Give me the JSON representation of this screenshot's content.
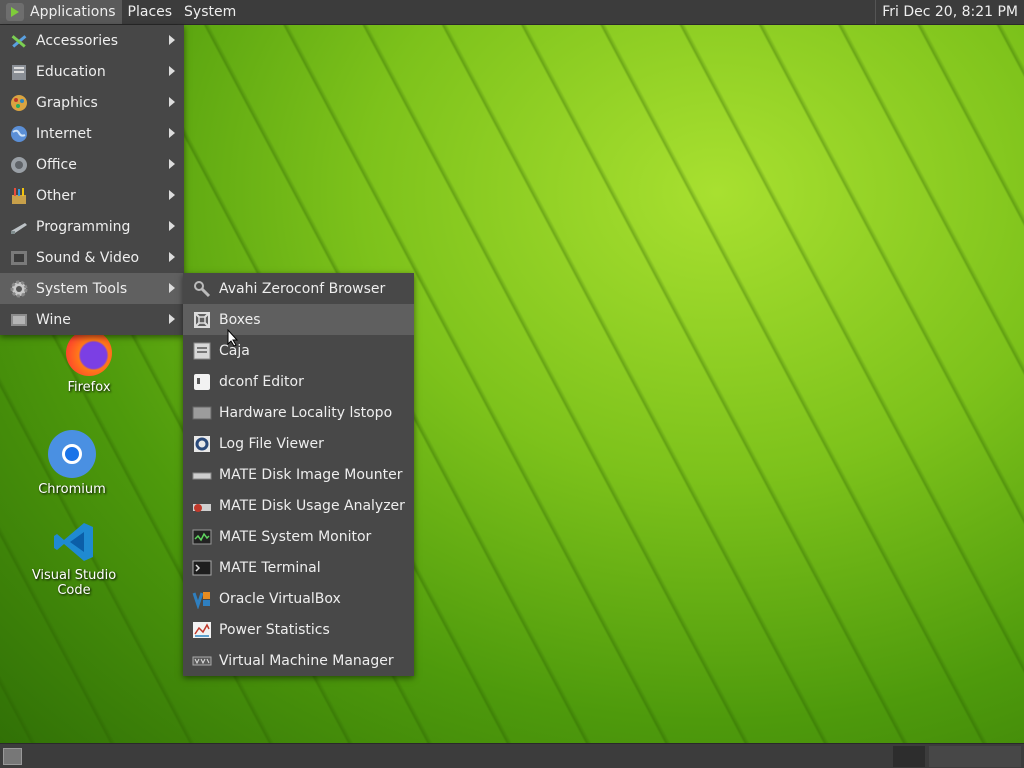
{
  "top_panel": {
    "applications_label": "Applications",
    "places_label": "Places",
    "system_label": "System",
    "clock": "Fri Dec 20,  8:21 PM"
  },
  "apps_menu": {
    "items": [
      {
        "label": "Accessories",
        "icon": "accessories-icon"
      },
      {
        "label": "Education",
        "icon": "education-icon"
      },
      {
        "label": "Graphics",
        "icon": "graphics-icon"
      },
      {
        "label": "Internet",
        "icon": "internet-icon"
      },
      {
        "label": "Office",
        "icon": "office-icon"
      },
      {
        "label": "Other",
        "icon": "other-icon"
      },
      {
        "label": "Programming",
        "icon": "programming-icon"
      },
      {
        "label": "Sound & Video",
        "icon": "sound-video-icon"
      },
      {
        "label": "System Tools",
        "icon": "system-tools-icon"
      },
      {
        "label": "Wine",
        "icon": "wine-icon"
      }
    ],
    "highlighted": "System Tools"
  },
  "system_tools_menu": {
    "items": [
      {
        "label": "Avahi Zeroconf Browser",
        "icon": "avahi-icon"
      },
      {
        "label": "Boxes",
        "icon": "boxes-icon"
      },
      {
        "label": "Caja",
        "icon": "caja-icon"
      },
      {
        "label": "dconf Editor",
        "icon": "dconf-icon"
      },
      {
        "label": "Hardware Locality lstopo",
        "icon": "lstopo-icon"
      },
      {
        "label": "Log File Viewer",
        "icon": "log-viewer-icon"
      },
      {
        "label": "MATE Disk Image Mounter",
        "icon": "disk-mounter-icon"
      },
      {
        "label": "MATE Disk Usage Analyzer",
        "icon": "disk-usage-icon"
      },
      {
        "label": "MATE System Monitor",
        "icon": "system-monitor-icon"
      },
      {
        "label": "MATE Terminal",
        "icon": "terminal-icon"
      },
      {
        "label": "Oracle VirtualBox",
        "icon": "virtualbox-icon"
      },
      {
        "label": "Power Statistics",
        "icon": "power-stats-icon"
      },
      {
        "label": "Virtual Machine Manager",
        "icon": "vm-manager-icon"
      }
    ],
    "highlighted": "Boxes"
  },
  "desktop": {
    "firefox_label": "Firefox",
    "chromium_label": "Chromium",
    "vscode_label": "Visual Studio Code"
  }
}
